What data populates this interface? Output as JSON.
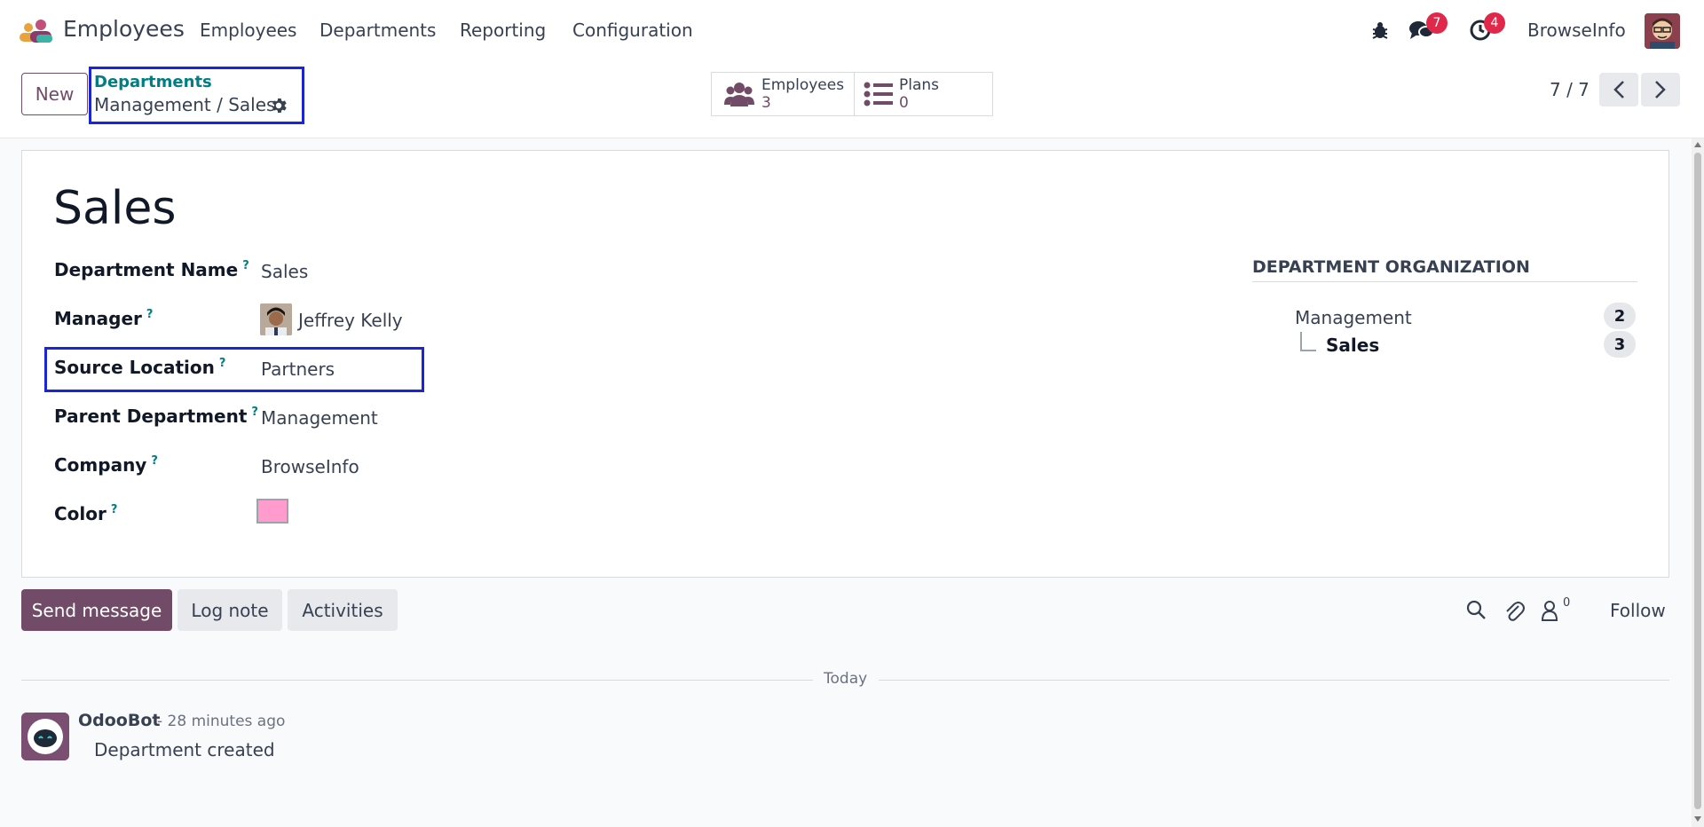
{
  "navbar": {
    "app_name": "Employees",
    "menus": [
      "Employees",
      "Departments",
      "Reporting",
      "Configuration"
    ],
    "messages_badge": "7",
    "activities_badge": "4",
    "company": "BrowseInfo"
  },
  "control_panel": {
    "new_label": "New",
    "breadcrumb_parent": "Departments",
    "breadcrumb_current": "Management / Sales",
    "smart_buttons": [
      {
        "label": "Employees",
        "value": "3",
        "icon": "users-icon"
      },
      {
        "label": "Plans",
        "value": "0",
        "icon": "list-icon"
      }
    ],
    "pager": "7 / 7"
  },
  "form": {
    "title": "Sales",
    "fields": [
      {
        "label": "Department Name",
        "value": "Sales"
      },
      {
        "label": "Manager",
        "value": "Jeffrey Kelly"
      },
      {
        "label": "Source Location",
        "value": "Partners"
      },
      {
        "label": "Parent Department",
        "value": "Management"
      },
      {
        "label": "Company",
        "value": "BrowseInfo"
      },
      {
        "label": "Color",
        "value": ""
      }
    ],
    "help_mark": "?",
    "color_value": "#ff9ccd"
  },
  "organization": {
    "title": "DEPARTMENT ORGANIZATION",
    "items": [
      {
        "name": "Management",
        "count": "2"
      },
      {
        "name": "Sales",
        "count": "3"
      }
    ]
  },
  "chatter": {
    "send_message": "Send message",
    "log_note": "Log note",
    "activities": "Activities",
    "followers_count": "0",
    "follow": "Follow",
    "date_separator": "Today",
    "messages": [
      {
        "author": "OdooBot",
        "time": "- 28 minutes ago",
        "body": "Department created"
      }
    ]
  },
  "colors": {
    "brand": "#714b67",
    "link": "#017e84",
    "highlight": "#1a24d9"
  }
}
